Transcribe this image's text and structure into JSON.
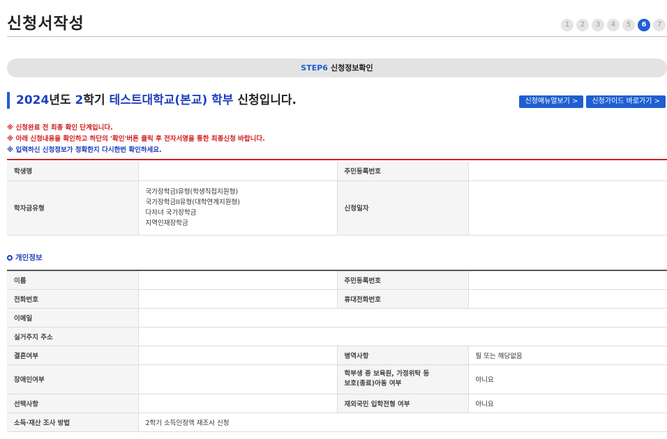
{
  "page": {
    "title": "신청서작성"
  },
  "steps": [
    "1",
    "2",
    "3",
    "4",
    "5",
    "6",
    "7"
  ],
  "step_bar": {
    "step_no": "STEP6",
    "label": "신청정보확인"
  },
  "heading": {
    "year": "2024",
    "year_suffix": "년도 ",
    "semester": "2",
    "semester_suffix": "학기 ",
    "school": "테스트대학교(본교) 학부",
    "tail": " 신청입니다."
  },
  "buttons": {
    "manual": "신청매뉴얼보기 >",
    "guide": "신청가이드 바로가기 >"
  },
  "notices": [
    "※ 신청완료 전 최종 확인 단계입니다.",
    "※ 아래 신청내용을 확인하고 하단의 '확인'버튼 클릭 후 전자서명을 통한 최종신청 바랍니다.",
    "※ 입력하신 신청정보가 정확한지 다시한번 확인하세요."
  ],
  "top_table": {
    "student_label": "학생명",
    "student_value": "",
    "rrn_label": "주민등록번호",
    "rrn_value": "",
    "type_label": "학자금유형",
    "types": [
      "국가장학금I유형(학생직접지원형)",
      "국가장학금II유형(대학연계지원형)",
      "다자녀 국가장학금",
      "지역인재장학금"
    ],
    "date_label": "신청일자",
    "date_value": ""
  },
  "personal": {
    "section_title": "개인정보",
    "name_label": "이름",
    "rrn_label": "주민등록번호",
    "phone_label": "전화번호",
    "mobile_label": "휴대전화번호",
    "email_label": "이메일",
    "address_label": "실거주지 주소",
    "marriage_label": "결혼여부",
    "military_label": "병역사항",
    "military_value": "필 또는 해당없음",
    "disability_label": "장애인여부",
    "childcare_label_1": "학부생 중 보육원, 가정위탁 등",
    "childcare_label_2": "보호(종료)아동 여부",
    "childcare_value": "아니요",
    "optional_label": "선택사항",
    "foreign_label": "재외국민 입학전형 여부",
    "foreign_value": "아니요",
    "income_label": "소득·재산 조사 방법",
    "income_value": "2학기 소득인정액 재조사 신청"
  }
}
